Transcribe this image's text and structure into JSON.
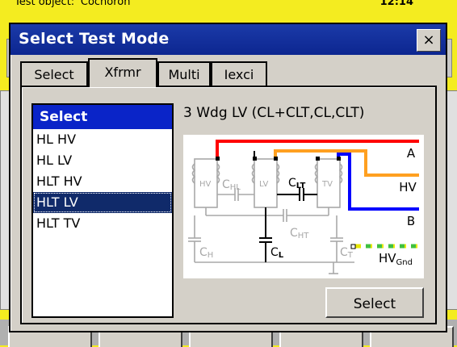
{
  "background": {
    "title_text": "Test object: 'Cochoron'",
    "clock": "12:14"
  },
  "dialog": {
    "title": "Select Test Mode",
    "close_label": "×"
  },
  "tabs": [
    {
      "label": "Select",
      "active": false
    },
    {
      "label": "Xfrmr",
      "active": true
    },
    {
      "label": "Multi",
      "active": false
    },
    {
      "label": "Iexci",
      "active": false
    }
  ],
  "list": {
    "header": "Select",
    "items": [
      "HL  HV",
      "HL  LV",
      "HLT  HV",
      "HLT  LV",
      "HLT  TV"
    ],
    "selected_index": 3
  },
  "config": {
    "label": "3 Wdg LV (CL+CLT,CL,CLT)"
  },
  "diagram": {
    "terminals": [
      "A",
      "HV",
      "B",
      "HV"
    ],
    "ground_subscript": "Gnd",
    "winding_labels": [
      "HV",
      "LV",
      "TV"
    ],
    "cap_labels": {
      "chl_main": "C",
      "chl_sub": "HL",
      "clt_main": "C",
      "clt_sub": "LT",
      "cht_main": "C",
      "cht_sub": "HT",
      "ch_main": "C",
      "ch_sub": "H",
      "cl_main": "C",
      "cl_sub": "L",
      "ct_main": "C",
      "ct_sub": "T"
    },
    "colors": {
      "red": "#ff0000",
      "orange": "#ffa020",
      "blue": "#0000ff",
      "ground_yellow": "#e8e800",
      "ground_green": "#40c040",
      "gray": "#a8a8a8"
    }
  },
  "buttons": {
    "select_label": "Select"
  }
}
